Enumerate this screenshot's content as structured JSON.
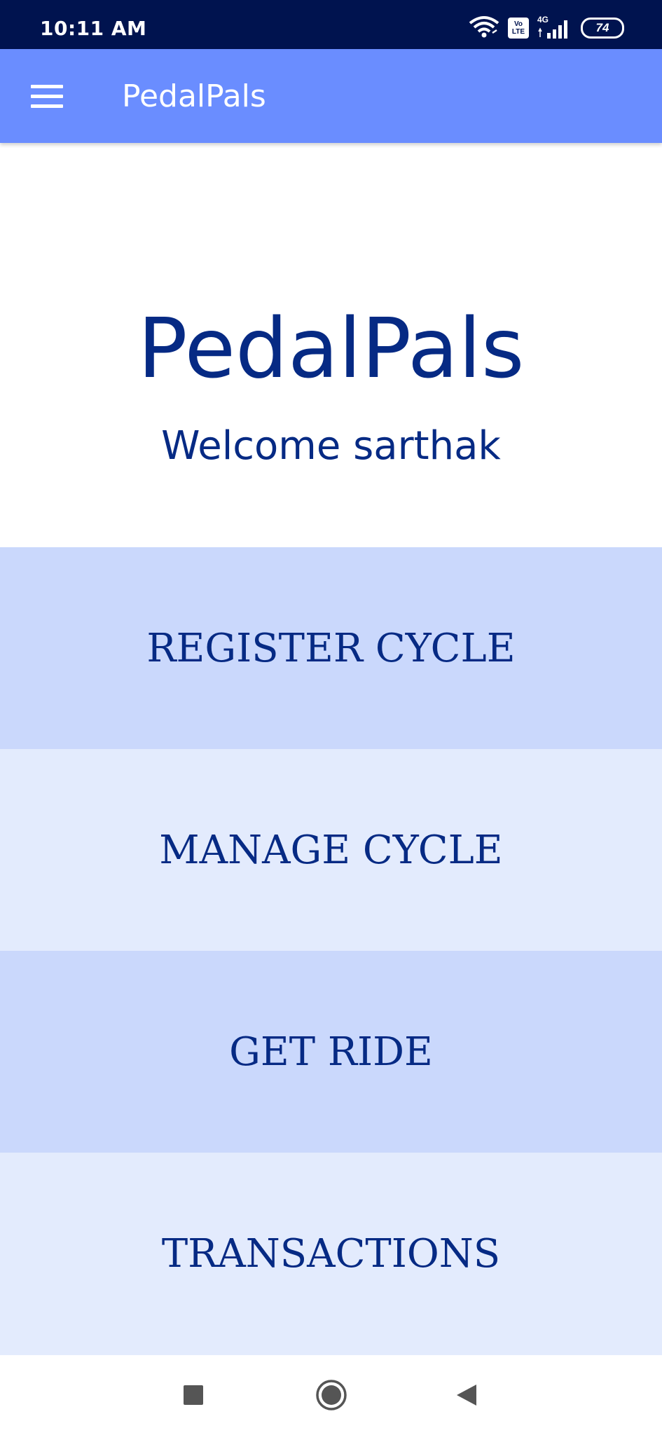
{
  "status_bar": {
    "time": "10:11 AM",
    "volte_label": "Vo LTE",
    "network_label": "4G",
    "battery_level": "74",
    "icons": [
      "wifi-icon",
      "volte-icon",
      "signal-icon",
      "battery-icon"
    ]
  },
  "app_bar": {
    "title": "PedalPals",
    "menu_icon": "hamburger-menu-icon"
  },
  "hero": {
    "title": "PedalPals",
    "welcome": "Welcome sarthak"
  },
  "menu": {
    "items": [
      {
        "label": "REGISTER CYCLE"
      },
      {
        "label": "MANAGE CYCLE"
      },
      {
        "label": "GET RIDE"
      },
      {
        "label": "TRANSACTIONS"
      }
    ]
  },
  "nav_bar": {
    "icons": [
      "recent-apps-icon",
      "home-icon",
      "back-icon"
    ]
  },
  "colors": {
    "status_bar_bg": "#00134f",
    "app_bar_bg": "#6a8dff",
    "text_primary": "#062a84",
    "tile_dark": "#cad8fc",
    "tile_light": "#e3ebfd"
  }
}
